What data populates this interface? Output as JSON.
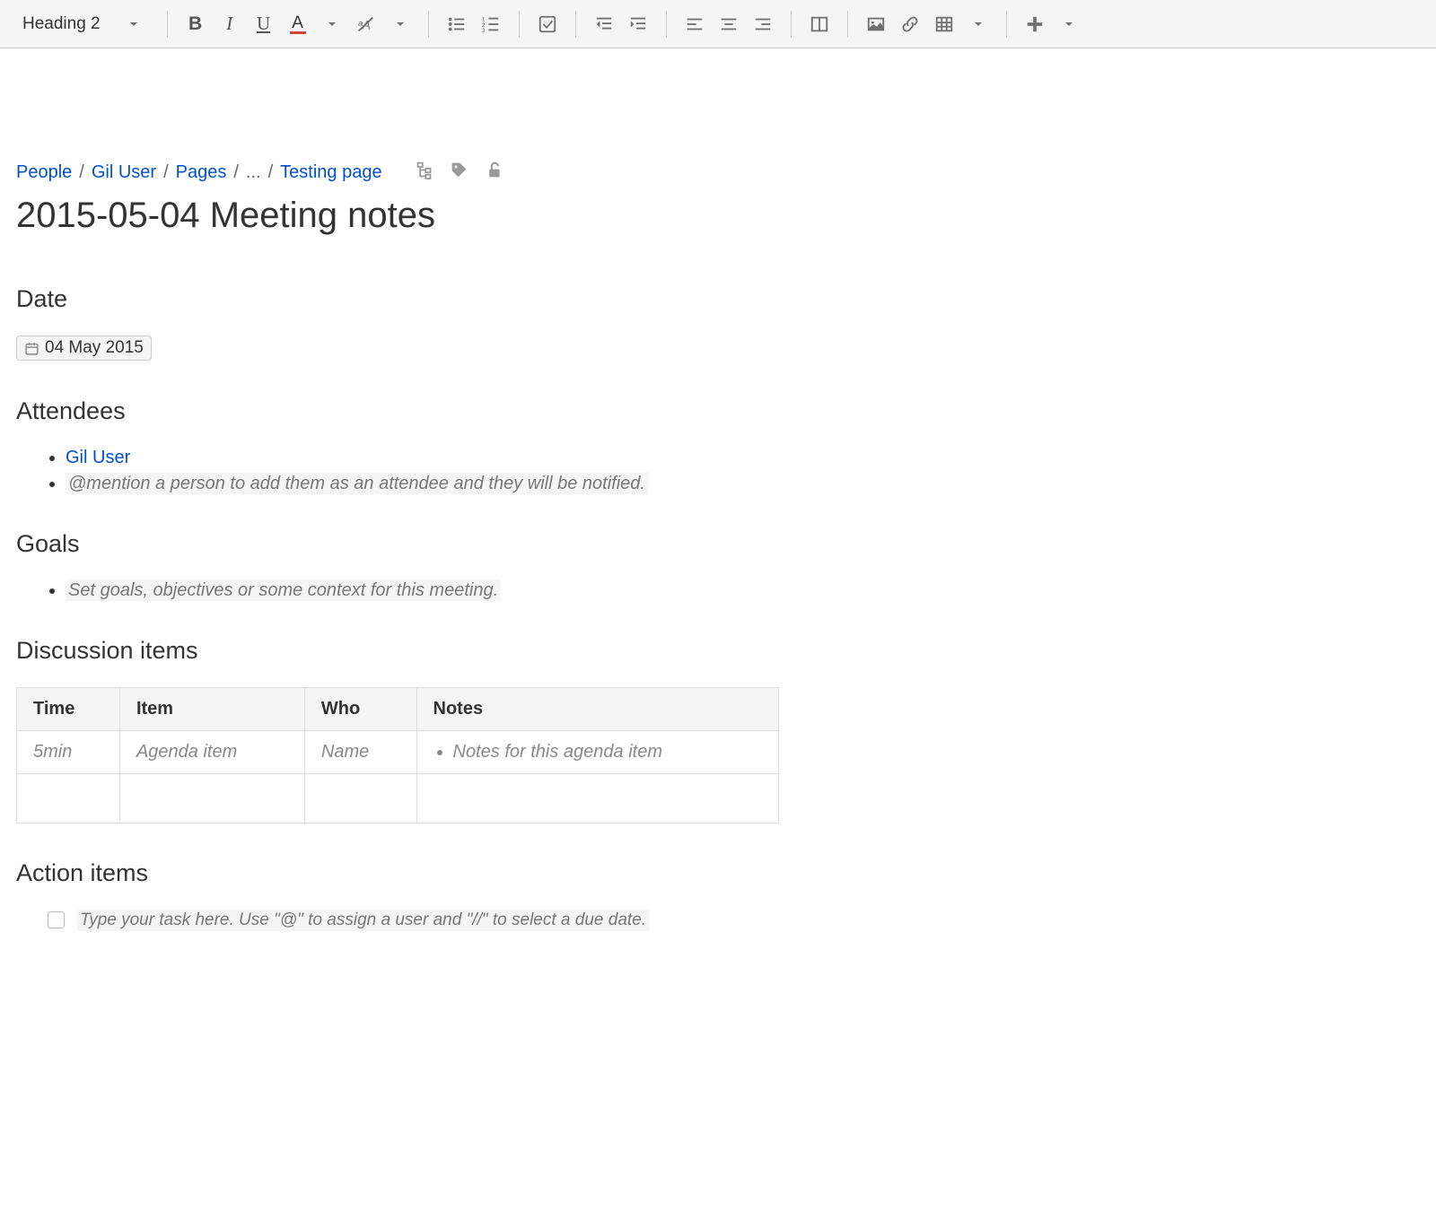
{
  "toolbar": {
    "format_dropdown": "Heading 2"
  },
  "breadcrumb": {
    "items": [
      "People",
      "Gil User",
      "Pages"
    ],
    "ellipsis": "...",
    "current": "Testing page"
  },
  "page": {
    "title": "2015-05-04 Meeting notes"
  },
  "sections": {
    "date": {
      "heading": "Date",
      "value": "04 May 2015"
    },
    "attendees": {
      "heading": "Attendees",
      "items": [
        {
          "type": "mention",
          "text": "Gil User"
        },
        {
          "type": "placeholder",
          "text": "@mention a person to add them as an attendee and they will be notified."
        }
      ]
    },
    "goals": {
      "heading": "Goals",
      "items": [
        {
          "type": "placeholder",
          "text": "Set goals, objectives or some context for this meeting."
        }
      ]
    },
    "discussion": {
      "heading": "Discussion items",
      "columns": [
        "Time",
        "Item",
        "Who",
        "Notes"
      ],
      "rows": [
        {
          "time": "5min",
          "item": "Agenda item",
          "who": "Name",
          "notes": "Notes for this agenda item"
        },
        {
          "time": "",
          "item": "",
          "who": "",
          "notes": ""
        }
      ]
    },
    "action": {
      "heading": "Action items",
      "task_placeholder": "Type your task here. Use \"@\" to assign a user and \"//\" to select a due date."
    }
  }
}
